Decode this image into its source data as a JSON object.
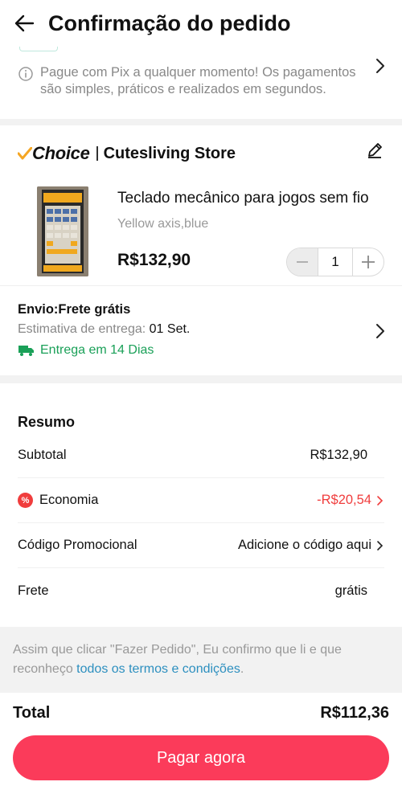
{
  "header": {
    "title": "Confirmação do pedido"
  },
  "pix": {
    "text": "Pague com Pix a qualquer momento! Os pagamentos são simples, práticos e realizados em segundos."
  },
  "store": {
    "choice_label": "Choice",
    "name": "Cutesliving Store",
    "product": {
      "title": "Teclado mecânico para jogos sem fio",
      "variant": "Yellow axis,blue",
      "price": "R$132,90",
      "quantity": "1"
    },
    "shipping": {
      "title": "Envio:Frete grátis",
      "estimate_label": "Estimativa de entrega:",
      "estimate_value": "01 Set.",
      "days": "Entrega em 14 Dias"
    }
  },
  "summary": {
    "title": "Resumo",
    "subtotal_label": "Subtotal",
    "subtotal_value": "R$132,90",
    "economy_label": "Economia",
    "economy_value": "-R$20,54",
    "promo_label": "Código Promocional",
    "promo_value": "Adicione o código aqui",
    "shipping_label": "Frete",
    "shipping_value": "grátis"
  },
  "terms": {
    "text": "Assim que clicar \"Fazer Pedido\", Eu confirmo que li e que reconheço",
    "link": "todos os termos e condições",
    "end": "."
  },
  "footer": {
    "total_label": "Total",
    "total_value": "R$112,36",
    "pay_label": "Pagar agora"
  },
  "colors": {
    "accent": "#fb3b5a",
    "discount": "#f03d3d",
    "delivery": "#1aa058",
    "link": "#2c8fbf"
  }
}
